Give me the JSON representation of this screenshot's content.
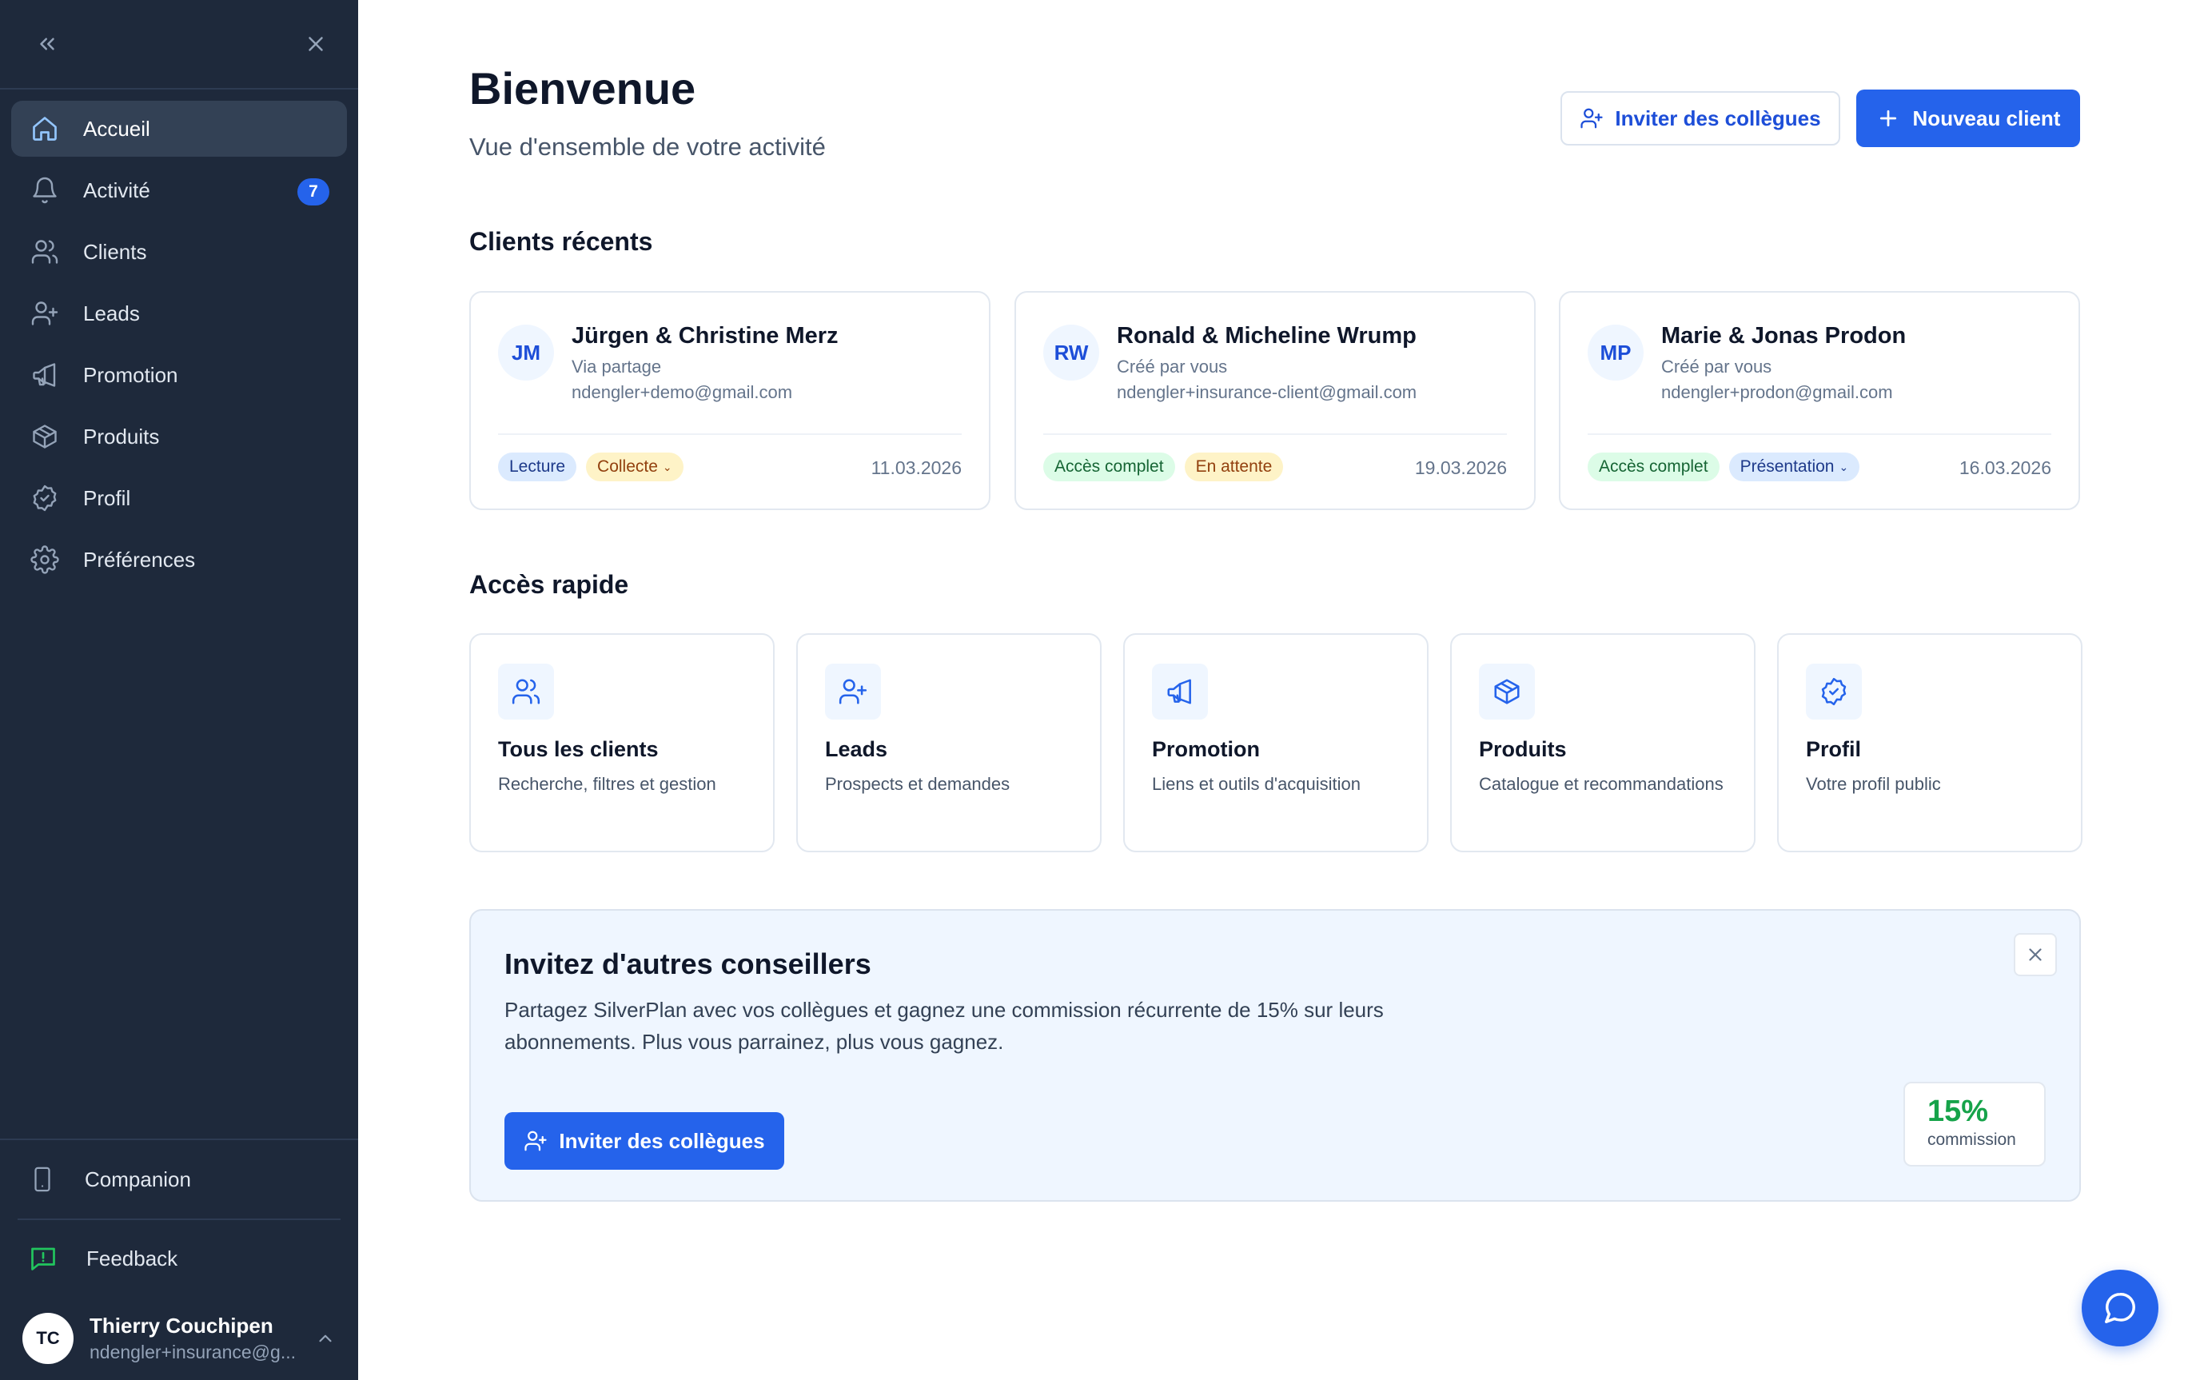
{
  "sidebar": {
    "items": [
      {
        "label": "Accueil"
      },
      {
        "label": "Activité",
        "badge": "7"
      },
      {
        "label": "Clients"
      },
      {
        "label": "Leads"
      },
      {
        "label": "Promotion"
      },
      {
        "label": "Produits"
      },
      {
        "label": "Profil"
      },
      {
        "label": "Préférences"
      }
    ],
    "companion": "Companion",
    "feedback": "Feedback",
    "user": {
      "initials": "TC",
      "name": "Thierry Couchipen",
      "email": "ndengler+insurance@g..."
    }
  },
  "header": {
    "title": "Bienvenue",
    "subtitle": "Vue d'ensemble de votre activité",
    "invite_label": "Inviter des collègues",
    "new_client_label": "Nouveau client"
  },
  "recent_clients": {
    "title": "Clients récents",
    "items": [
      {
        "initials": "JM",
        "name": "Jürgen & Christine Merz",
        "via": "Via partage",
        "email": "ndengler+demo@gmail.com",
        "tag1": "Lecture",
        "tag2": "Collecte",
        "date": "11.03.2026"
      },
      {
        "initials": "RW",
        "name": "Ronald & Micheline Wrump",
        "via": "Créé par vous",
        "email": "ndengler+insurance-client@gmail.com",
        "tag1": "Accès complet",
        "tag2": "En attente",
        "date": "19.03.2026"
      },
      {
        "initials": "MP",
        "name": "Marie & Jonas Prodon",
        "via": "Créé par vous",
        "email": "ndengler+prodon@gmail.com",
        "tag1": "Accès complet",
        "tag2": "Présentation",
        "date": "16.03.2026"
      }
    ]
  },
  "quick_access": {
    "title": "Accès rapide",
    "items": [
      {
        "title": "Tous les clients",
        "desc": "Recherche, filtres et gestion",
        "icon": "users-icon"
      },
      {
        "title": "Leads",
        "desc": "Prospects et demandes",
        "icon": "user-plus-icon"
      },
      {
        "title": "Promotion",
        "desc": "Liens et outils d'acquisition",
        "icon": "megaphone-icon"
      },
      {
        "title": "Produits",
        "desc": "Catalogue et recommandations",
        "icon": "box-icon"
      },
      {
        "title": "Profil",
        "desc": "Votre profil public",
        "icon": "badge-check-icon"
      }
    ]
  },
  "banner": {
    "title": "Invitez d'autres conseillers",
    "text": "Partagez SilverPlan avec vos collègues et gagnez une commission récurrente de 15% sur leurs abonnements. Plus vous parrainez, plus vous gagnez.",
    "button": "Inviter des collègues",
    "stat_value": "15%",
    "stat_label": "commission"
  },
  "colors": {
    "sidebar_bg": "#1e293b",
    "accent": "#2563eb",
    "banner_bg": "#eff6ff",
    "success": "#16a34a"
  }
}
